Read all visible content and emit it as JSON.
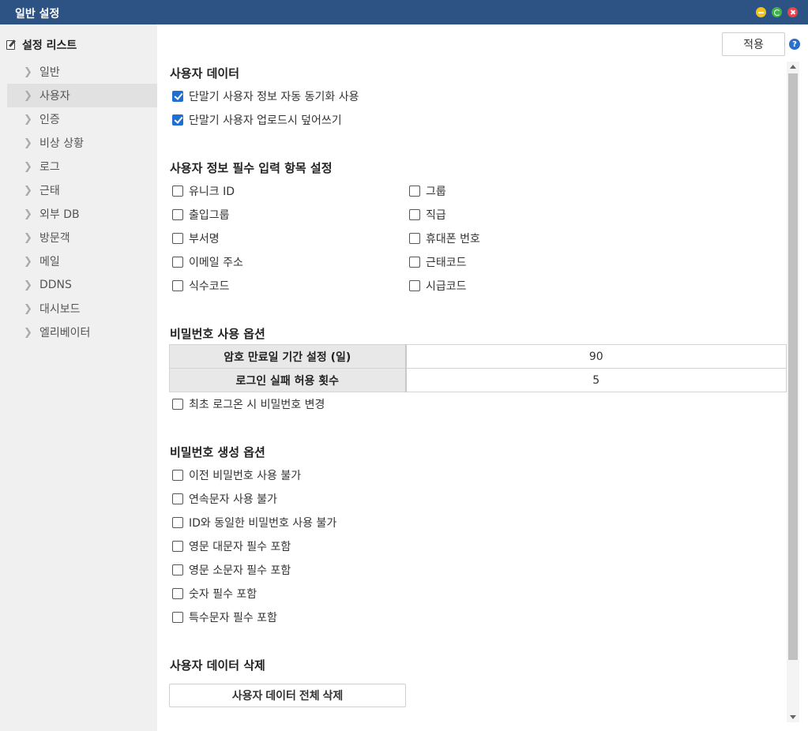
{
  "window": {
    "title": "일반 설정"
  },
  "sidebar": {
    "header": "설정 리스트",
    "items": [
      {
        "label": "일반"
      },
      {
        "label": "사용자"
      },
      {
        "label": "인증"
      },
      {
        "label": "비상 상황"
      },
      {
        "label": "로그"
      },
      {
        "label": "근태"
      },
      {
        "label": "외부 DB"
      },
      {
        "label": "방문객"
      },
      {
        "label": "메일"
      },
      {
        "label": "DDNS"
      },
      {
        "label": "대시보드"
      },
      {
        "label": "엘리베이터"
      }
    ],
    "active_index": 1
  },
  "toolbar": {
    "apply_label": "적용",
    "help_label": "?"
  },
  "user_data": {
    "title": "사용자 데이터",
    "options": [
      {
        "label": "단말기 사용자 정보 자동 동기화 사용",
        "checked": true
      },
      {
        "label": "단말기 사용자 업로드시 덮어쓰기",
        "checked": true
      }
    ]
  },
  "required_fields": {
    "title": "사용자 정보 필수 입력 항목 설정",
    "left": [
      {
        "label": "유니크 ID",
        "checked": false
      },
      {
        "label": "출입그룹",
        "checked": false
      },
      {
        "label": "부서명",
        "checked": false
      },
      {
        "label": "이메일 주소",
        "checked": false
      },
      {
        "label": "식수코드",
        "checked": false
      }
    ],
    "right": [
      {
        "label": "그룹",
        "checked": false
      },
      {
        "label": "직급",
        "checked": false
      },
      {
        "label": "휴대폰 번호",
        "checked": false
      },
      {
        "label": "근태코드",
        "checked": false
      },
      {
        "label": "시급코드",
        "checked": false
      }
    ]
  },
  "password_usage": {
    "title": "비밀번호 사용 옵션",
    "rows": [
      {
        "label": "암호 만료일 기간 설정 (일)",
        "value": "90"
      },
      {
        "label": "로그인 실패 허용 횟수",
        "value": "5"
      }
    ],
    "change_on_first_login": {
      "label": "최초 로그온 시 비밀번호 변경",
      "checked": false
    }
  },
  "password_generation": {
    "title": "비밀번호 생성 옵션",
    "options": [
      {
        "label": "이전 비밀번호 사용 불가",
        "checked": false
      },
      {
        "label": "연속문자 사용 불가",
        "checked": false
      },
      {
        "label": "ID와 동일한 비밀번호 사용 불가",
        "checked": false
      },
      {
        "label": "영문 대문자 필수 포함",
        "checked": false
      },
      {
        "label": "영문 소문자 필수 포함",
        "checked": false
      },
      {
        "label": "숫자 필수 포함",
        "checked": false
      },
      {
        "label": "특수문자 필수 포함",
        "checked": false
      }
    ]
  },
  "delete_section": {
    "title": "사용자 데이터 삭제",
    "button_label": "사용자 데이터 전체 삭제"
  }
}
